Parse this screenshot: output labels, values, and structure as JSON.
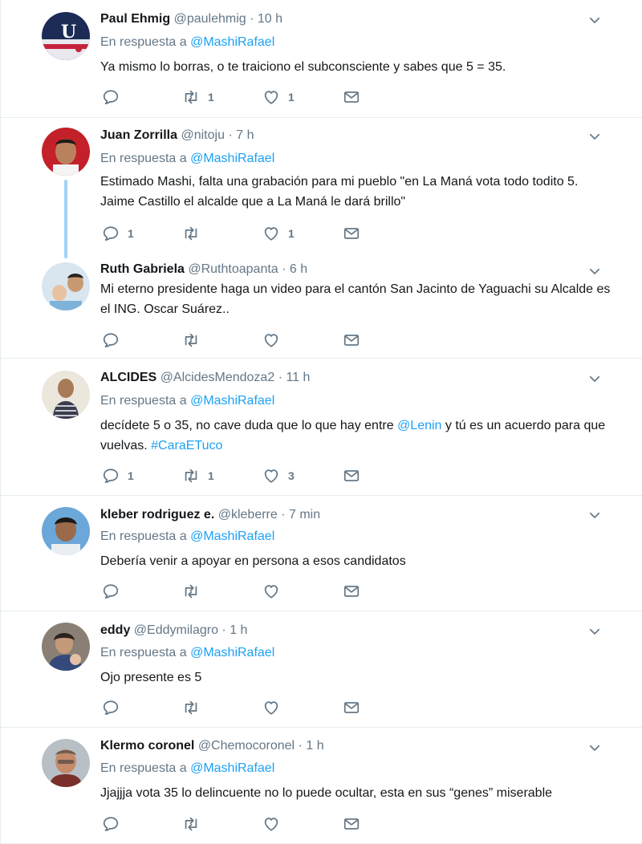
{
  "replying_prefix": "En respuesta a",
  "replying_target": "@MashiRafael",
  "colors": {
    "link": "#1da1f2",
    "muted": "#657786",
    "separator": "#e6ecf0",
    "thread": "#a3d3f5"
  },
  "tweets": [
    {
      "name": "Paul Ehmig",
      "handle": "@paulehmig",
      "time": "10 h",
      "text": "Ya mismo lo borras, o te traiciono el subconsciente y sabes que 5 = 35.",
      "replies": "",
      "retweets": "1",
      "likes": "1"
    },
    {
      "name": "Juan Zorrilla",
      "handle": "@nitoju",
      "time": "7 h",
      "text": "Estimado Mashi, falta una grabación para mi pueblo \"en La Maná vota todo todito 5. Jaime Castillo el alcalde que a La Maná le dará brillo\"",
      "replies": "1",
      "retweets": "",
      "likes": "1"
    },
    {
      "name": "Ruth Gabriela",
      "handle": "@Ruthtoapanta",
      "time": "6 h",
      "text": "Mi eterno presidente haga un video para el cantón San Jacinto de Yaguachi su Alcalde es el ING. Oscar Suárez..",
      "replies": "",
      "retweets": "",
      "likes": ""
    },
    {
      "name": "ALCIDES",
      "handle": "@AlcidesMendoza2",
      "time": "11 h",
      "text_before": "decídete 5 o 35, no cave duda que lo que hay entre ",
      "text_mention": "@Lenin",
      "text_middle": " y tú es un acuerdo para que vuelvas. ",
      "text_hashtag": "#CaraETuco",
      "replies": "1",
      "retweets": "1",
      "likes": "3"
    },
    {
      "name": "kleber rodriguez e.",
      "handle": "@kleberre",
      "time": "7 min",
      "text": "Debería venir a apoyar en persona a esos candidatos",
      "replies": "",
      "retweets": "",
      "likes": ""
    },
    {
      "name": "eddy",
      "handle": "@Eddymilagro",
      "time": "1 h",
      "text": "Ojo presente  es 5",
      "replies": "",
      "retweets": "",
      "likes": ""
    },
    {
      "name": "Klermo coronel",
      "handle": "@Chemocoronel",
      "time": "1 h",
      "text": "Jjajjja vota 35 lo delincuente no lo puede ocultar, esta en sus “genes” miserable",
      "replies": "",
      "retweets": "",
      "likes": ""
    }
  ]
}
